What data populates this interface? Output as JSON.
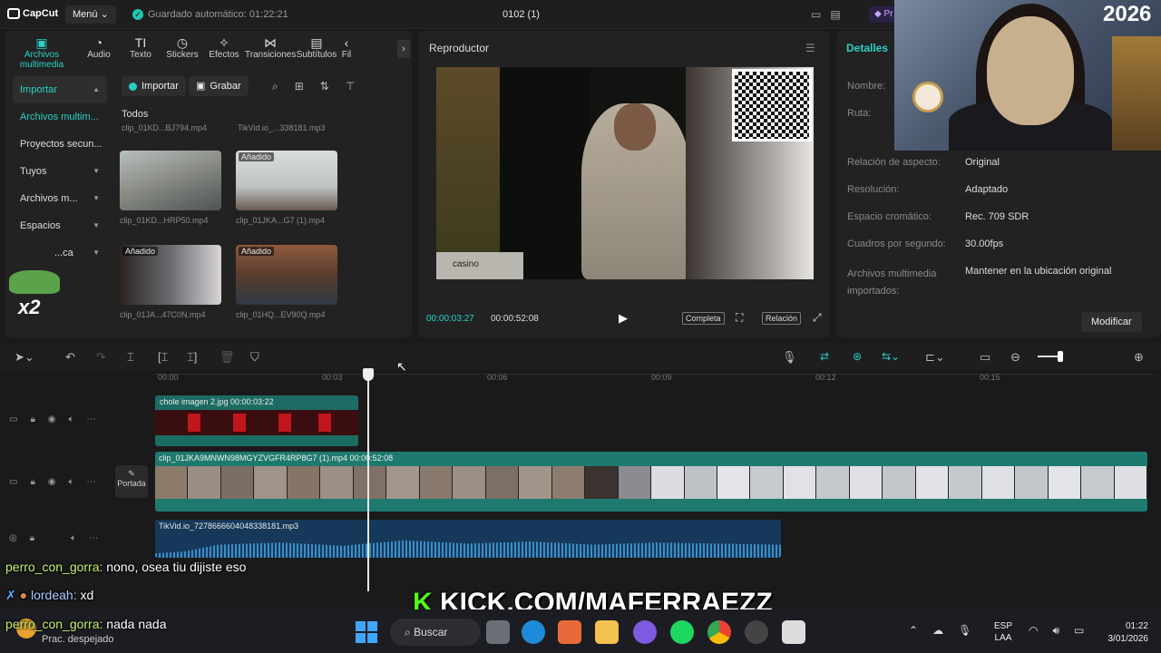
{
  "titlebar": {
    "app_name": "CapCut",
    "menu_label": "Menú",
    "autosave": "Guardado automático: 01:22:21",
    "project_title": "0102 (1)",
    "pro_label": "Pr"
  },
  "media_tools": [
    {
      "label": "Archivos multimedia",
      "icon": "media-icon"
    },
    {
      "label": "Audio",
      "icon": "audio-icon"
    },
    {
      "label": "Texto",
      "icon": "text-icon"
    },
    {
      "label": "Stickers",
      "icon": "sticker-icon"
    },
    {
      "label": "Efectos",
      "icon": "effects-icon"
    },
    {
      "label": "Transiciones",
      "icon": "transitions-icon"
    },
    {
      "label": "Subtítulos",
      "icon": "subtitles-icon"
    },
    {
      "label": "Fil",
      "icon": "filters-icon"
    }
  ],
  "sidebar": [
    {
      "label": "Importar",
      "chevron": true
    },
    {
      "label": "Archivos multim...",
      "chevron": false
    },
    {
      "label": "Proyectos secun...",
      "chevron": false
    },
    {
      "label": "Tuyos",
      "chevron": true
    },
    {
      "label": "Archivos m...",
      "chevron": true
    },
    {
      "label": "Espacios",
      "chevron": true
    },
    {
      "label": "...ca",
      "chevron": true
    }
  ],
  "media": {
    "import_label": "Importar",
    "grab_label": "Grabar",
    "all_label": "Todos",
    "top_captions": [
      "clip_01KD...BJ794.mp4",
      "TikVid.io_...338181.mp3"
    ],
    "clips": [
      {
        "caption": "clip_01KD...HRP50.mp4",
        "tag": ""
      },
      {
        "caption": "clip_01JKA...G7 (1).mp4",
        "tag": "Añadido"
      },
      {
        "caption": "clip_01JA...47C0N.mp4",
        "tag": "Añadido"
      },
      {
        "caption": "clip_01HQ...EV90Q.mp4",
        "tag": "Añadido"
      }
    ],
    "overlay_x2": "x2"
  },
  "player": {
    "title": "Reproductor",
    "current_time": "00:00:03:27",
    "total_time": "00:00:52:08",
    "btn_full": "Completa",
    "btn_ratio": "Relación",
    "video_watermark": "casino"
  },
  "details": {
    "tab": "Detalles",
    "fields": [
      {
        "label": "Nombre:",
        "value": ""
      },
      {
        "label": "Ruta:",
        "value": ""
      },
      {
        "label": "Relación de aspecto:",
        "value": "Original"
      },
      {
        "label": "Resolución:",
        "value": "Adaptado"
      },
      {
        "label": "Espacio cromático:",
        "value": "Rec. 709 SDR"
      },
      {
        "label": "Cuadros por segundo:",
        "value": "30.00fps"
      },
      {
        "label": "Archivos multimedia importados:",
        "value": "Mantener en la ubicación original"
      }
    ],
    "modify_label": "Modificar"
  },
  "webcam": {
    "year": "2026"
  },
  "ruler_ticks": [
    "00:00",
    "00:03",
    "00:06",
    "00:09",
    "00:12",
    "00:15"
  ],
  "timeline": {
    "image_clip": "chole imagen 2.jpg  00:00:03:22",
    "video_clip": "clip_01JKA9MNWN98MGYZVGFR4RP8G7 (1).mp4  00:00:52:08",
    "audio_clip": "TikVid.io_7278666604048338181.mp3",
    "cover_label": "Portada"
  },
  "chat": [
    {
      "user": "perro_con_gorra:",
      "text": "nono, osea tiu dijiste eso"
    },
    {
      "user": "lordeah:",
      "text": "xd"
    },
    {
      "user": "perro_con_gorra:",
      "text": "nada nada"
    }
  ],
  "kick": {
    "k": "K",
    "text": "KICK.COM/MAFERRAEZZ"
  },
  "taskbar": {
    "weather": "Prac. despejado",
    "search": "Buscar",
    "lang_1": "ESP",
    "lang_2": "LAA",
    "time": "01:22",
    "date": "3/01/2026"
  },
  "colors": {
    "accent": "#28d1c4",
    "chat_user": "#c5f16a",
    "kick_green": "#53fc18"
  }
}
